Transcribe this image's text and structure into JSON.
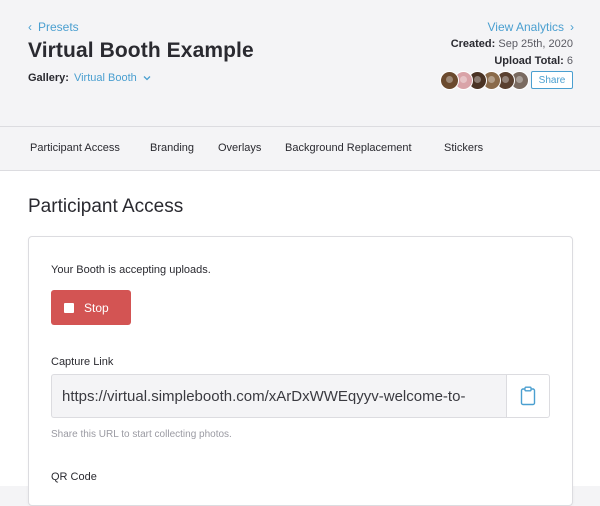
{
  "header": {
    "back_label": "Presets",
    "title": "Virtual Booth Example",
    "gallery_label": "Gallery:",
    "gallery_value": "Virtual Booth",
    "analytics_label": "View Analytics",
    "created_label": "Created:",
    "created_value": "Sep 25th, 2020",
    "upload_label": "Upload Total:",
    "upload_value": "6",
    "share_label": "Share",
    "avatar_colors": [
      "#6b4a2e",
      "#d9a3a8",
      "#4a3324",
      "#8a6a4a",
      "#5a4030",
      "#7a6a60"
    ]
  },
  "tabs": [
    {
      "label": "Participant Access"
    },
    {
      "label": "Branding"
    },
    {
      "label": "Overlays"
    },
    {
      "label": "Background Replacement"
    },
    {
      "label": "Stickers"
    }
  ],
  "section": {
    "title": "Participant Access",
    "status_text": "Your Booth is accepting uploads.",
    "stop_label": "Stop",
    "capture_label": "Capture Link",
    "capture_url": "https://virtual.simplebooth.com/xArDxWWEqyyv-welcome-to-",
    "hint": "Share this URL to start collecting photos.",
    "qr_label": "QR Code"
  },
  "colors": {
    "accent": "#4a9fd0",
    "stop": "#d35453"
  }
}
